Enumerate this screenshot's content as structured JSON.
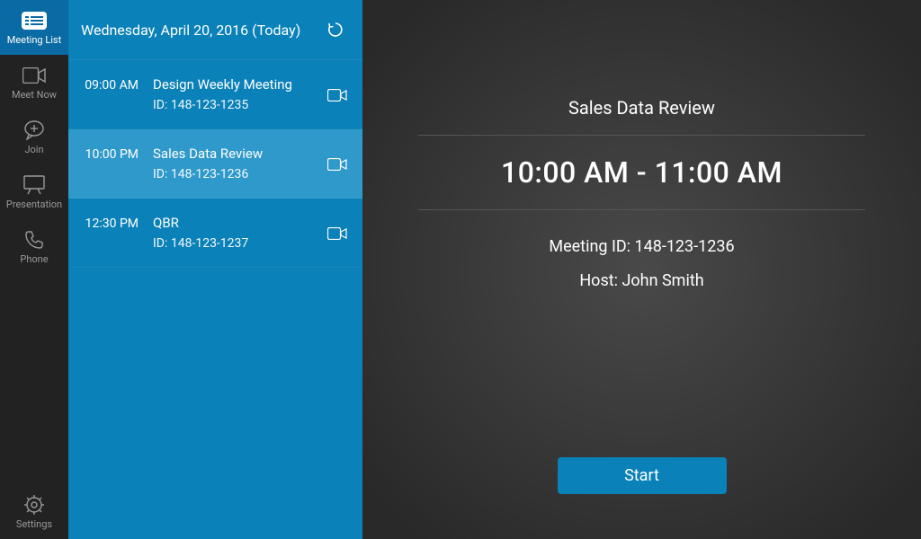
{
  "nav": {
    "items": [
      {
        "label": "Meeting List"
      },
      {
        "label": "Meet Now"
      },
      {
        "label": "Join"
      },
      {
        "label": "Presentation"
      },
      {
        "label": "Phone"
      }
    ],
    "settings_label": "Settings"
  },
  "list": {
    "date_header": "Wednesday, April 20, 2016 (Today)",
    "items": [
      {
        "time": "09:00 AM",
        "title": "Design Weekly Meeting",
        "id_label": "ID: 148-123-1235"
      },
      {
        "time": "10:00 PM",
        "title": "Sales Data Review",
        "id_label": "ID: 148-123-1236"
      },
      {
        "time": "12:30 PM",
        "title": "QBR",
        "id_label": "ID: 148-123-1237"
      }
    ]
  },
  "detail": {
    "title": "Sales Data Review",
    "time_range": "10:00 AM - 11:00 AM",
    "meeting_id_line": "Meeting ID: 148-123-1236",
    "host_line": "Host: John Smith",
    "start_label": "Start"
  }
}
